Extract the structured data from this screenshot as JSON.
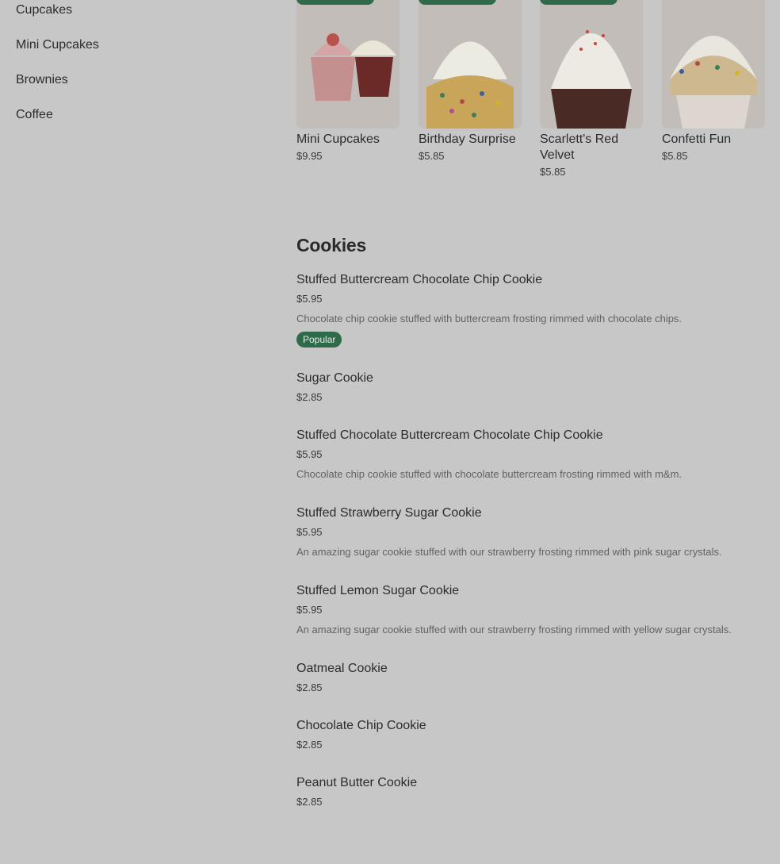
{
  "sidebar": {
    "items": [
      {
        "label": "Cupcakes"
      },
      {
        "label": "Mini Cupcakes"
      },
      {
        "label": "Brownies"
      },
      {
        "label": "Coffee"
      }
    ]
  },
  "featured": [
    {
      "name": "Mini Cupcakes",
      "price": "$9.95",
      "image_icon": "mini-cupcakes-photo"
    },
    {
      "name": "Birthday Surprise",
      "price": "$5.85",
      "image_icon": "birthday-surprise-photo"
    },
    {
      "name": "Scarlett's Red Velvet",
      "price": "$5.85",
      "image_icon": "red-velvet-photo"
    },
    {
      "name": "Confetti Fun",
      "price": "$5.85",
      "image_icon": "confetti-fun-photo"
    }
  ],
  "section": {
    "title": "Cookies"
  },
  "cookies": [
    {
      "name": "Stuffed Buttercream Chocolate Chip Cookie",
      "price": "$5.95",
      "desc": "Chocolate chip cookie stuffed with buttercream frosting rimmed with chocolate chips.",
      "badge": "Popular"
    },
    {
      "name": "Sugar Cookie",
      "price": "$2.85"
    },
    {
      "name": "Stuffed Chocolate Buttercream Chocolate Chip Cookie",
      "price": "$5.95",
      "desc": "Chocolate chip cookie stuffed with chocolate buttercream frosting rimmed with m&m."
    },
    {
      "name": "Stuffed Strawberry Sugar Cookie",
      "price": "$5.95",
      "desc": "An amazing sugar cookie stuffed with our strawberry frosting rimmed with pink sugar crystals."
    },
    {
      "name": "Stuffed Lemon Sugar Cookie",
      "price": "$5.95",
      "desc": "An amazing sugar cookie stuffed with our strawberry frosting rimmed with yellow sugar crystals."
    },
    {
      "name": "Oatmeal Cookie",
      "price": "$2.85"
    },
    {
      "name": "Chocolate Chip Cookie",
      "price": "$2.85"
    },
    {
      "name": "Peanut Butter Cookie",
      "price": "$2.85"
    }
  ],
  "colors": {
    "background": "#c7c7c7",
    "badge": "#2f6b4a"
  }
}
